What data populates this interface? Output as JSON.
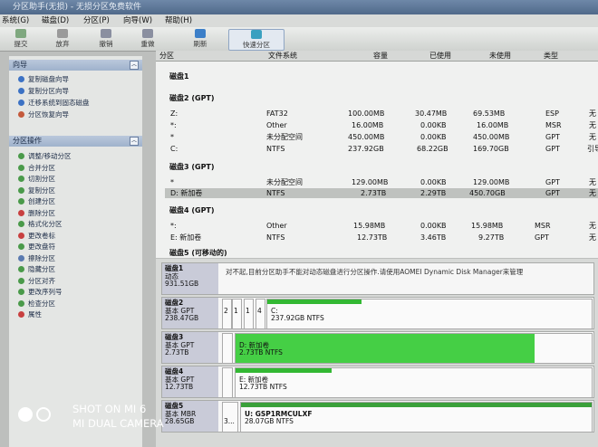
{
  "title": "分区助手(无损) - 无损分区免费软件",
  "menu": [
    "系统(G)",
    "磁盘(D)",
    "分区(P)",
    "向导(W)",
    "帮助(H)"
  ],
  "toolbar": [
    "提交",
    "放弃",
    "撤销",
    "重做",
    "刷新",
    "快速分区"
  ],
  "wizard_panel": {
    "title": "向导",
    "items": [
      "复制磁盘向导",
      "复制分区向导",
      "迁移系统到固态磁盘",
      "分区恢复向导"
    ]
  },
  "ops_panel": {
    "title": "分区操作",
    "items": [
      "调整/移动分区",
      "合并分区",
      "切割分区",
      "复制分区",
      "创建分区",
      "删除分区",
      "格式化分区",
      "更改卷标",
      "更改盘符",
      "擦除分区",
      "隐藏分区",
      "分区对齐",
      "更改序列号",
      "检查分区",
      "属性"
    ]
  },
  "columns": [
    "分区",
    "文件系统",
    "容量",
    "已使用",
    "未使用",
    "类型"
  ],
  "disks": [
    {
      "title": "磁盘1",
      "rows": []
    },
    {
      "title": "磁盘2 (GPT)",
      "rows": [
        [
          "Z:",
          "FAT32",
          "100.00MB",
          "30.47MB",
          "69.53MB",
          "ESP",
          "无"
        ],
        [
          "*:",
          "Other",
          "16.00MB",
          "0.00KB",
          "16.00MB",
          "MSR",
          "无"
        ],
        [
          "*",
          "未分配空间",
          "450.00MB",
          "0.00KB",
          "450.00MB",
          "GPT",
          "无"
        ],
        [
          "C:",
          "NTFS",
          "237.92GB",
          "68.22GB",
          "169.70GB",
          "GPT",
          "引导"
        ]
      ]
    },
    {
      "title": "磁盘3 (GPT)",
      "rows": [
        [
          "*",
          "未分配空间",
          "129.00MB",
          "0.00KB",
          "129.00MB",
          "GPT",
          "无"
        ],
        [
          "D: 新加卷",
          "NTFS",
          "2.73TB",
          "2.29TB",
          "450.70GB",
          "GPT",
          "无"
        ]
      ]
    },
    {
      "title": "磁盘4 (GPT)",
      "rows": [
        [
          "*:",
          "Other",
          "15.98MB",
          "0.00KB",
          "15.98MB",
          "MSR",
          "无"
        ],
        [
          "E: 新加卷",
          "NTFS",
          "12.73TB",
          "3.46TB",
          "9.27TB",
          "GPT",
          "无"
        ]
      ]
    },
    {
      "title": "磁盘5 (可移动的)",
      "rows": []
    }
  ],
  "disk_map": [
    {
      "name": "磁盘1",
      "type": "动态",
      "size": "931.51GB",
      "message": "对不起,目前分区助手不能对动态磁盘进行分区操作.请使用AOMEI Dynamic Disk Manager来管理"
    },
    {
      "name": "磁盘2",
      "type": "基本 GPT",
      "size": "238.47GB",
      "small_parts": [
        "2",
        "1",
        "1",
        "4"
      ],
      "part_label": "C:",
      "part_detail": "237.92GB NTFS",
      "fill": 0.29
    },
    {
      "name": "磁盘3",
      "type": "基本 GPT",
      "size": "2.73TB",
      "part_label": "D: 新加卷",
      "part_detail": "2.73TB NTFS",
      "fill": 0.84
    },
    {
      "name": "磁盘4",
      "type": "基本 GPT",
      "size": "12.73TB",
      "part_label": "E: 新加卷",
      "part_detail": "12.73TB NTFS",
      "fill": 0.27
    },
    {
      "name": "磁盘5",
      "type": "基本 MBR",
      "size": "28.65GB",
      "small_parts": [
        "3..."
      ],
      "part_label": "U: GSP1RMCULXF",
      "part_detail": "28.07GB NTFS"
    }
  ],
  "watermark": {
    "line1": "SHOT ON MI 6",
    "line2": "MI DUAL CAMERA"
  }
}
